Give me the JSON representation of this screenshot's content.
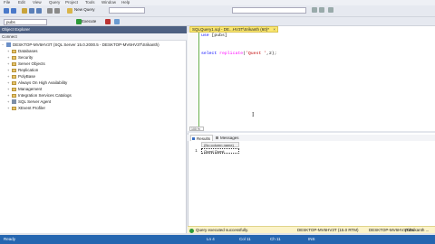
{
  "menu": [
    "File",
    "Edit",
    "View",
    "Query",
    "Project",
    "Tools",
    "Window",
    "Help"
  ],
  "toolbar": {
    "new_query": "New Query",
    "execute": "Execute",
    "database": "pubs"
  },
  "object_explorer": {
    "title": "Object Explorer",
    "connect": "Connect",
    "server": "DESKTOP-MV6HV3T (SQL Server 15.0.2000.5 - DESKTOP-MV6HV3T\\Srikanth)",
    "items": [
      "Databases",
      "Security",
      "Server Objects",
      "Replication",
      "PolyBase",
      "Always On High Availability",
      "Management",
      "Integration Services Catalogs",
      "SQL Server Agent",
      "XEvent Profiler"
    ]
  },
  "editor": {
    "tab_title": "SQLQuery1.sql - DE...HV3T\\Srikanth (60)*",
    "tab_close": "×",
    "line1": {
      "kw": "use",
      "rest": " [pubs]"
    },
    "line2": {
      "kw": "select",
      "fn": "replicate",
      "str": "'Quest '",
      "num": "2"
    },
    "zoom": "100 %"
  },
  "results": {
    "tabs": [
      "Results",
      "Messages"
    ],
    "column_header": "(No column name)",
    "row_number": "1",
    "cell_value": "Quest Quest"
  },
  "query_status": {
    "message": "Query executed successfully.",
    "server": "DESKTOP-MV6HV3T (15.0 RTM)",
    "user": "DESKTOP-MV6HV3T\\Srikanth ...",
    "database": "pubs"
  },
  "statusbar": {
    "state": "Ready",
    "ln": "Ln 4",
    "col": "Col 11",
    "ch": "Ch 11",
    "mode": "INS"
  },
  "colors": {
    "statusbar": "#2566b0",
    "tab_active": "#fbe76f",
    "object_explorer_title": "#4d6082",
    "keyword": "#0000ff",
    "function": "#ff00ff",
    "string": "#c00000"
  }
}
